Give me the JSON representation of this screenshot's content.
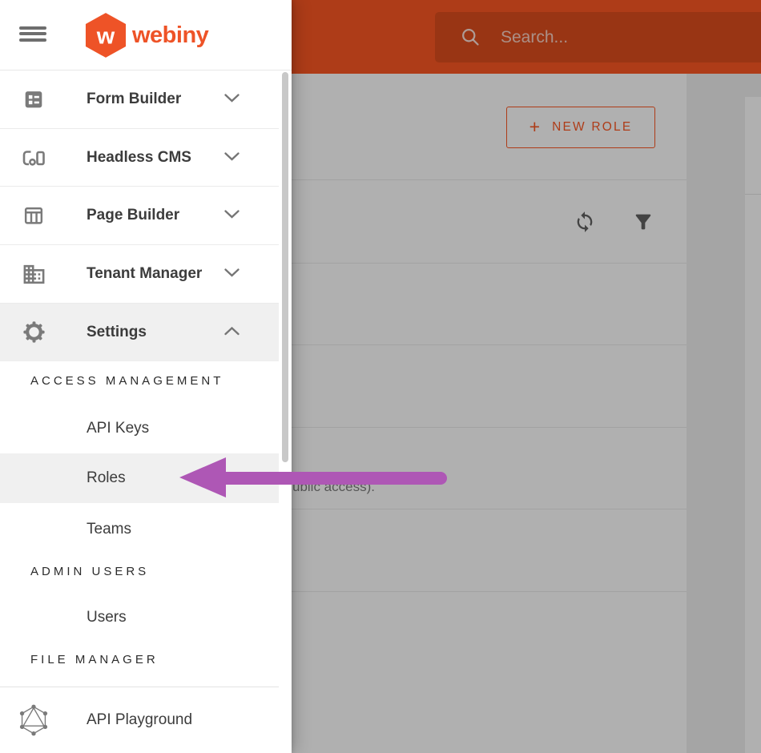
{
  "brand": {
    "name": "webiny",
    "monogram": "w"
  },
  "topbar": {
    "search_placeholder": "Search..."
  },
  "drawer": {
    "menu": [
      {
        "label": "Form Builder",
        "state": "collapsed"
      },
      {
        "label": "Headless CMS",
        "state": "collapsed"
      },
      {
        "label": "Page Builder",
        "state": "collapsed"
      },
      {
        "label": "Tenant Manager",
        "state": "collapsed"
      },
      {
        "label": "Settings",
        "state": "expanded"
      }
    ],
    "settings_sections": [
      {
        "title": "ACCESS MANAGEMENT",
        "items": [
          {
            "label": "API Keys",
            "highlighted": false
          },
          {
            "label": "Roles",
            "highlighted": true
          },
          {
            "label": "Teams",
            "highlighted": false
          }
        ]
      },
      {
        "title": "ADMIN USERS",
        "items": [
          {
            "label": "Users",
            "highlighted": false
          }
        ]
      },
      {
        "title": "FILE MANAGER",
        "items": []
      }
    ],
    "footer": {
      "label": "API Playground"
    }
  },
  "content": {
    "new_role_plus": "+",
    "new_role_button": "NEW ROLE",
    "partial_row_text": "ublic access)."
  },
  "annotation": {
    "points_at": "Roles"
  },
  "colors": {
    "header-orange": "#FA5723",
    "brand-orange": "#EE5327",
    "accent": "#FA5723",
    "arrow-purple": "#AE57B5",
    "icon-grey": "#7A7A7A",
    "highlight-grey": "#F0F0F0",
    "scrim": "rgba(0,0,0,0.30)"
  }
}
